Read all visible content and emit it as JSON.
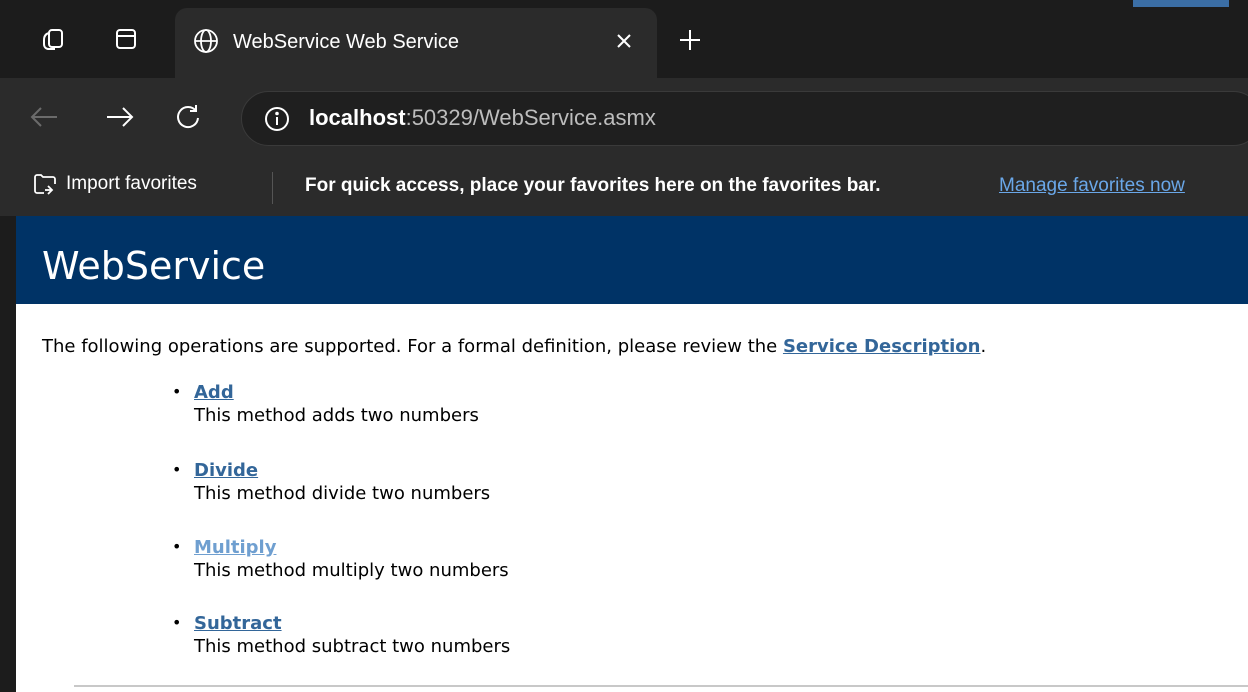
{
  "browser": {
    "tab": {
      "title": "WebService Web Service"
    },
    "address": {
      "host": "localhost",
      "path": ":50329/WebService.asmx"
    },
    "favorites_bar": {
      "import_label": "Import favorites",
      "message": "For quick access, place your favorites here on the favorites bar.",
      "manage_link": "Manage favorites now"
    }
  },
  "page": {
    "heading": "WebService",
    "intro_text": "The following operations are supported. For a formal definition, please review the ",
    "intro_link": "Service Description",
    "intro_end": ".",
    "operations": [
      {
        "name": "Add",
        "description": "This method adds two numbers"
      },
      {
        "name": "Divide",
        "description": "This method divide two numbers"
      },
      {
        "name": "Multiply",
        "description": "This method multiply two numbers"
      },
      {
        "name": "Subtract",
        "description": "This method subtract two numbers"
      }
    ]
  },
  "colors": {
    "header_bg": "#003366",
    "link": "#336699",
    "visited_link": "#6f9fd0"
  }
}
